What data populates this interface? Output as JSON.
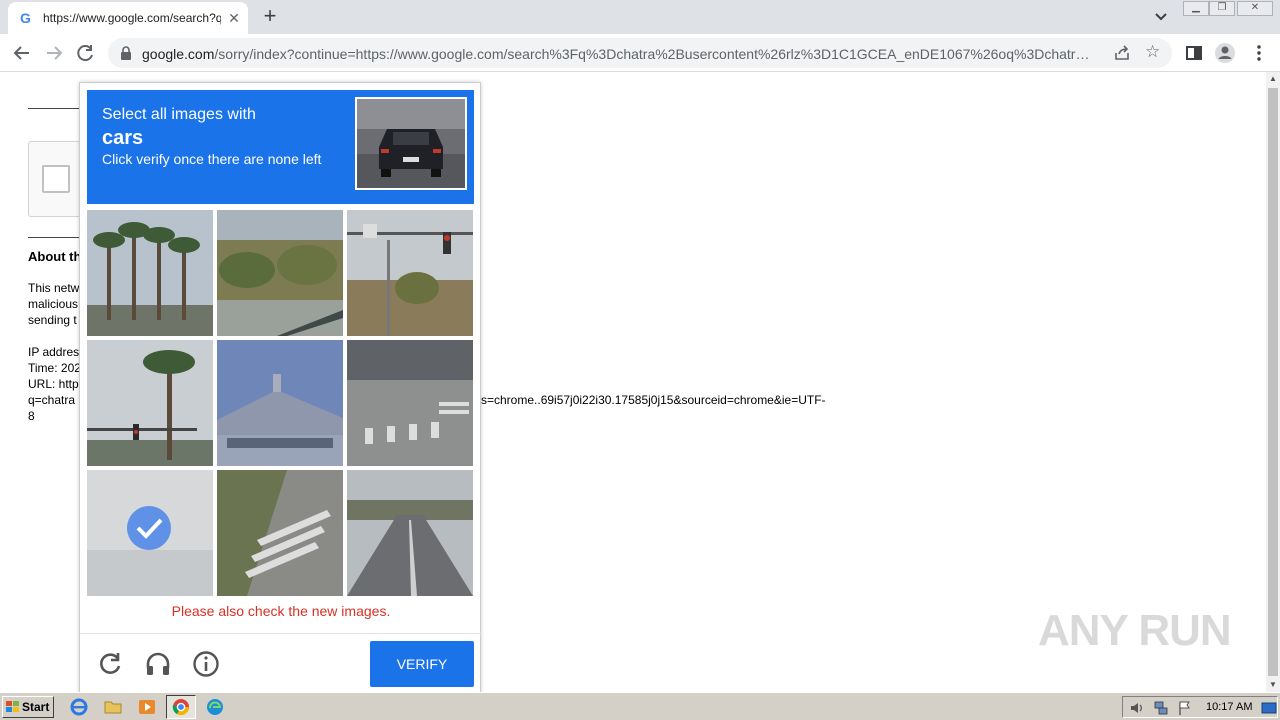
{
  "browser": {
    "tab_title": "https://www.google.com/search?q=",
    "tab_close": "✕",
    "favicon": "G",
    "new_tab": "+",
    "url_host": "google.com",
    "url_path": "/sorry/index?continue=https://www.google.com/search%3Fq%3Dchatra%2Busercontent%26rlz%3D1C1GCEA_enDE1067%26oq%3Dchatr…",
    "icons": [
      "back-arrow-icon",
      "forward-arrow-icon",
      "reload-icon",
      "lock-icon",
      "share-icon",
      "star-icon",
      "side-panel-icon",
      "profile-icon",
      "menu-dots-icon"
    ]
  },
  "page": {
    "about_heading": "About th",
    "network_lines": [
      "This netw",
      "malicious",
      "sending t"
    ],
    "ip_label": "IP addres",
    "time_label": "Time: 202",
    "url_label": "URL: http",
    "url_line2": "q=chatra",
    "url_tail": "s=chrome..69i57j0i22i30.17585j0j15&sourceid=chrome&ie=UTF-",
    "url_line3": "8"
  },
  "captcha": {
    "line1": "Select all images with",
    "target": "cars",
    "line3": "Click verify once there are none left",
    "error": "Please also check the new images.",
    "verify_label": "VERIFY",
    "tiles": [
      {
        "name": "palm-trees",
        "selected": false
      },
      {
        "name": "shrubs-hillside",
        "selected": false
      },
      {
        "name": "traffic-light-street",
        "selected": false
      },
      {
        "name": "palm-tree-traffic-light",
        "selected": false
      },
      {
        "name": "house-roof",
        "selected": false
      },
      {
        "name": "crosswalk-road",
        "selected": false
      },
      {
        "name": "fading-selected-tile",
        "selected": true
      },
      {
        "name": "crosswalk-diagonal",
        "selected": false
      },
      {
        "name": "road-perspective",
        "selected": false
      }
    ],
    "footer_icons": [
      "reload-icon",
      "headphones-icon",
      "info-icon"
    ]
  },
  "watermark": "ANY RUN",
  "taskbar": {
    "start_label": "Start",
    "clock": "10:17 AM",
    "apps": [
      "ie-icon",
      "folder-icon",
      "media-player-icon",
      "chrome-icon",
      "edge-icon"
    ]
  }
}
